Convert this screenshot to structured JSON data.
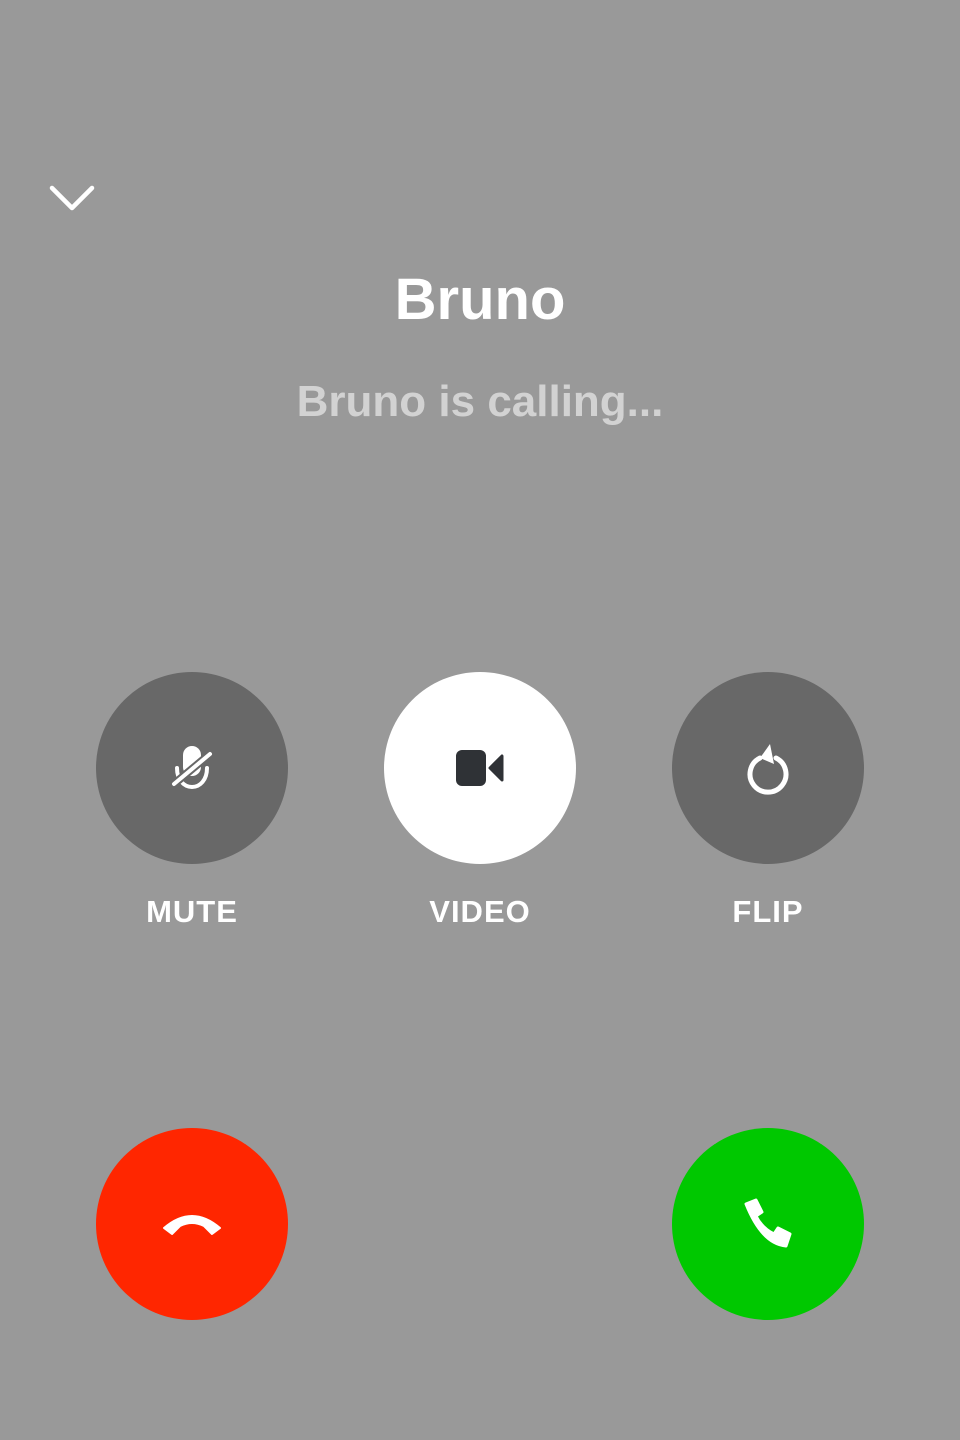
{
  "caller": {
    "name": "Bruno",
    "status": "Bruno is calling..."
  },
  "controls": {
    "mute_label": "MUTE",
    "video_label": "VIDEO",
    "flip_label": "FLIP"
  },
  "icons": {
    "collapse": "chevron-down-icon",
    "mute": "mic-off-icon",
    "video": "video-camera-icon",
    "flip": "rotate-camera-icon",
    "decline": "phone-hangup-icon",
    "accept": "phone-icon"
  },
  "colors": {
    "background": "#999999",
    "control_dark": "#686868",
    "control_light": "#ffffff",
    "decline": "#ff2600",
    "accept": "#00c800"
  }
}
